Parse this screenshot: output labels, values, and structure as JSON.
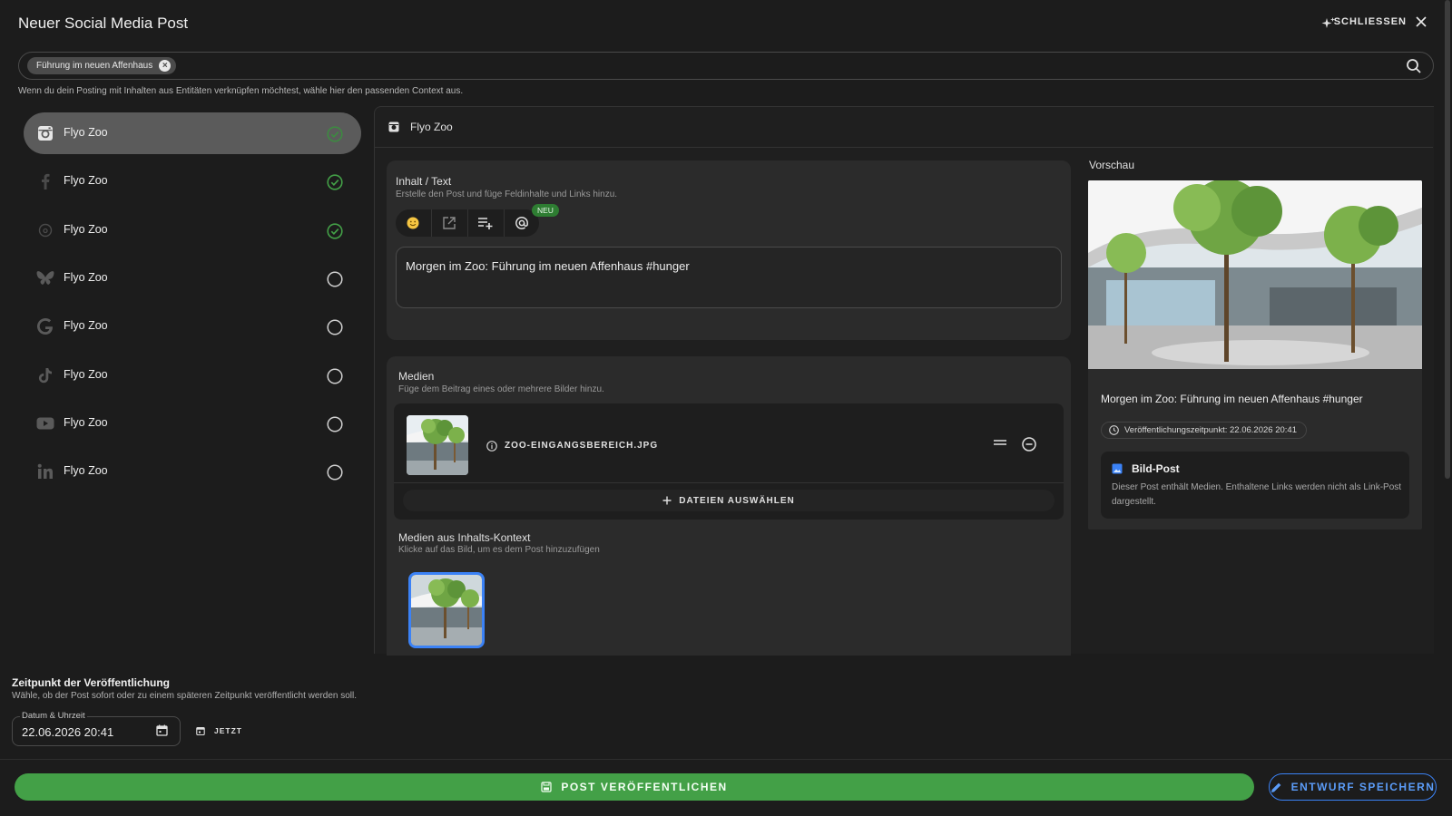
{
  "header": {
    "title": "Neuer Social Media Post",
    "close_label": "SCHLIESSEN"
  },
  "context": {
    "chip_label": "Führung im neuen Affenhaus",
    "hint": "Wenn du dein Posting mit Inhalten aus Entitäten verknüpfen möchtest, wähle hier den passenden Context aus."
  },
  "accounts": [
    {
      "platform": "instagram",
      "icon": "instagram-icon",
      "name": "Flyo Zoo",
      "active": true,
      "checked": true
    },
    {
      "platform": "facebook",
      "icon": "facebook-icon",
      "name": "Flyo Zoo",
      "active": false,
      "checked": true
    },
    {
      "platform": "threads",
      "icon": "threads-icon",
      "name": "Flyo Zoo",
      "active": false,
      "checked": true
    },
    {
      "platform": "bluesky",
      "icon": "bluesky-icon",
      "name": "Flyo Zoo",
      "active": false,
      "checked": false
    },
    {
      "platform": "google",
      "icon": "google-icon",
      "name": "Flyo Zoo",
      "active": false,
      "checked": false
    },
    {
      "platform": "tiktok",
      "icon": "tiktok-icon",
      "name": "Flyo Zoo",
      "active": false,
      "checked": false
    },
    {
      "platform": "youtube",
      "icon": "youtube-icon",
      "name": "Flyo Zoo",
      "active": false,
      "checked": false
    },
    {
      "platform": "linkedin",
      "icon": "linkedin-icon",
      "name": "Flyo Zoo",
      "active": false,
      "checked": false
    }
  ],
  "panel": {
    "account_name": "Flyo Zoo"
  },
  "text_card": {
    "title": "Inhalt / Text",
    "subtitle": "Erstelle den Post und füge Feldinhalte und Links hinzu.",
    "badge": "NEU",
    "content": "Morgen im Zoo: Führung im neuen Affenhaus #hunger"
  },
  "media_card": {
    "title": "Medien",
    "subtitle": "Füge dem Beitrag eines oder mehrere Bilder hinzu.",
    "file_name": "ZOO-EINGANGSBEREICH.JPG",
    "pick_label": "DATEIEN AUSWÄHLEN",
    "context_title": "Medien aus Inhalts-Kontext",
    "context_subtitle": "Klicke auf das Bild, um es dem Post hinzuzufügen"
  },
  "preview": {
    "title": "Vorschau",
    "text": "Morgen im Zoo: Führung im neuen Affenhaus #hunger",
    "publish_time": "Veröffentlichungszeitpunkt: 22.06.2026 20:41",
    "type_title": "Bild-Post",
    "type_desc": "Dieser Post enthält Medien. Enthaltene Links werden nicht als Link-Post dargestellt."
  },
  "schedule": {
    "title": "Zeitpunkt der Veröffentlichung",
    "subtitle": "Wähle, ob der Post sofort oder zu einem späteren Zeitpunkt veröffentlicht werden soll.",
    "field_label": "Datum & Uhrzeit",
    "value": "22.06.2026 20:41",
    "now_label": "JETZT"
  },
  "actions": {
    "publish_label": "POST VERÖFFENTLICHEN",
    "draft_label": "ENTWURF SPEICHERN"
  },
  "colors": {
    "accent_green": "#43a047",
    "accent_blue": "#3b82f6",
    "background": "#1c1c1c"
  }
}
